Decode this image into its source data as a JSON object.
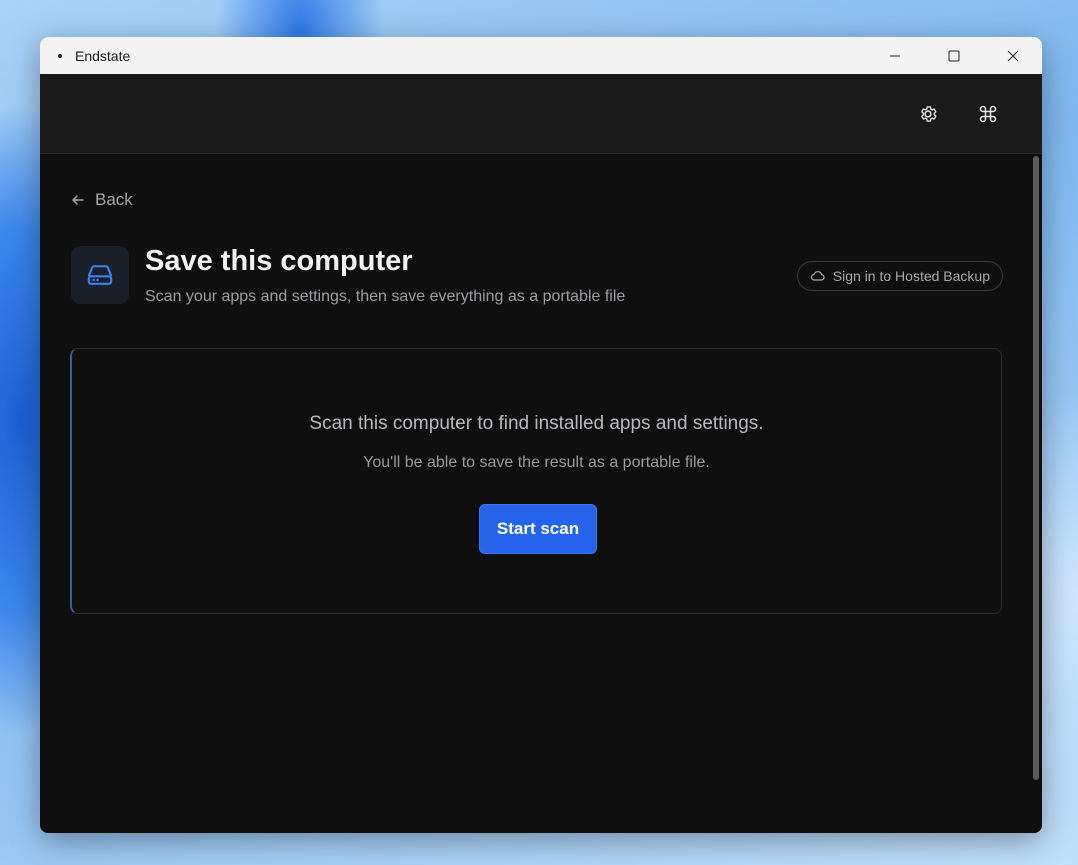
{
  "window": {
    "title": "Endstate"
  },
  "toolbar": {
    "settings_icon": "gear-icon",
    "command_icon": "command-icon"
  },
  "page": {
    "back_label": "Back",
    "title": "Save this computer",
    "subtitle": "Scan your apps and settings, then save everything as a portable file",
    "header_icon": "hard-drive-icon",
    "signin_label": "Sign in to Hosted Backup",
    "signin_icon": "cloud-icon"
  },
  "scan_card": {
    "message": "Scan this computer to find installed apps and settings.",
    "sub_message": "You'll be able to save the result as a portable file.",
    "start_label": "Start scan"
  },
  "colors": {
    "accent": "#2563eb",
    "window_bg": "#0f0f10",
    "topbar_bg": "#1a1a1b"
  }
}
